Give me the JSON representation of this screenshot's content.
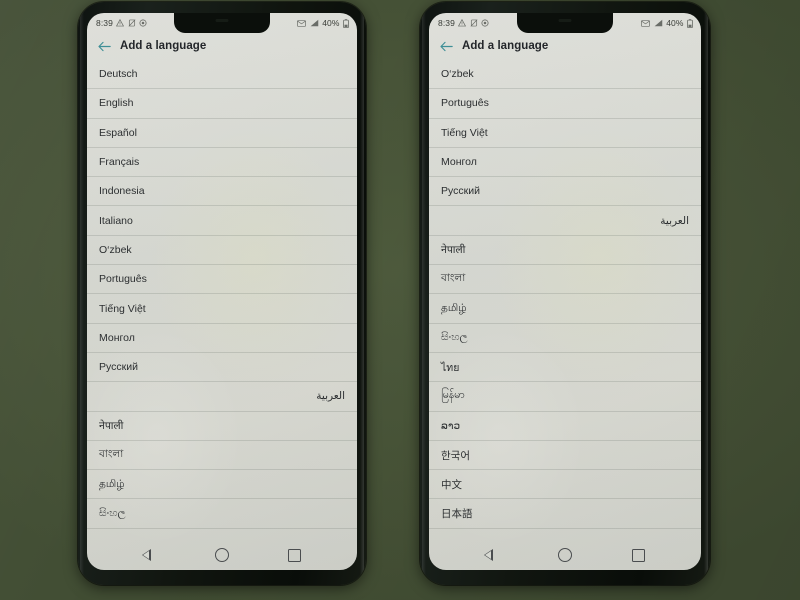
{
  "scene": {
    "description": "two-phones-photo",
    "background_color": "#4a5639",
    "device_body_color": "#121711",
    "screen_color": "#d8dad3"
  },
  "status_bar": {
    "clock": "8:39",
    "left_icons": [
      "warning-triangle-icon",
      "no-sim-icon",
      "data-saver-icon"
    ],
    "right_icons": [
      "envelope-icon",
      "signal-bars-icon"
    ],
    "battery_percent": "40%",
    "battery_icon": "battery-icon"
  },
  "app_bar": {
    "back_icon": "back-arrow-icon",
    "back_icon_color": "#3f8f96",
    "title": "Add a language"
  },
  "nav_bar": {
    "back_label": "back-triangle",
    "home_label": "home-circle",
    "recents_label": "recents-square"
  },
  "phones": [
    {
      "id": "left",
      "languages": [
        "Deutsch",
        "English",
        "Español",
        "Français",
        "Indonesia",
        "Italiano",
        "O‘zbek",
        "Português",
        "Tiếng Việt",
        "Монгол",
        "Русский",
        "العربية",
        "नेपाली",
        "বাংলা",
        "தமிழ்",
        "සිංහල"
      ],
      "rtl_indexes": [
        11
      ]
    },
    {
      "id": "right",
      "languages": [
        "O‘zbek",
        "Português",
        "Tiếng Việt",
        "Монгол",
        "Русский",
        "العربية",
        "नेपाली",
        "বাংলা",
        "தமிழ்",
        "සිංහල",
        "ไทย",
        "မြန်မာ",
        "ລາວ",
        "한국어",
        "中文",
        "日本語"
      ],
      "rtl_indexes": [
        5
      ]
    }
  ]
}
